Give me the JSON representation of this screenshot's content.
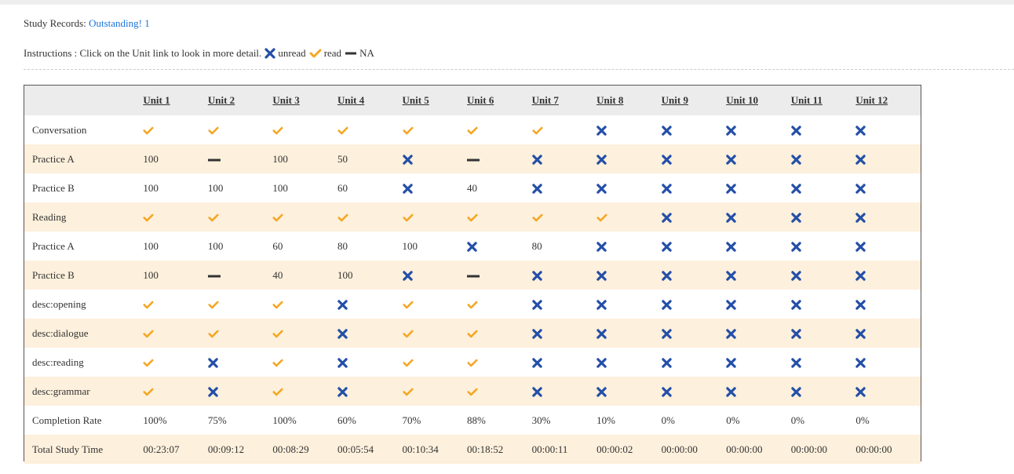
{
  "header": {
    "records_label": "Study Records:",
    "records_link": "Outstanding! 1",
    "instructions_text": "Instructions : Click on the Unit link to look in more detail.",
    "legend": {
      "unread": "unread",
      "read": "read",
      "na": "NA"
    }
  },
  "colors": {
    "read": "#f5a623",
    "unread": "#244fa8",
    "na": "#333333",
    "link": "#1a73d9",
    "alt_row": "#fdf0dc"
  },
  "units": [
    "Unit 1",
    "Unit 2",
    "Unit 3",
    "Unit 4",
    "Unit 5",
    "Unit 6",
    "Unit 7",
    "Unit 8",
    "Unit 9",
    "Unit 10",
    "Unit 11",
    "Unit 12"
  ],
  "rows": [
    {
      "label": "Conversation",
      "cells": [
        "read",
        "read",
        "read",
        "read",
        "read",
        "read",
        "read",
        "unread",
        "unread",
        "unread",
        "unread",
        "unread"
      ]
    },
    {
      "label": "Practice A",
      "cells": [
        "100",
        "na",
        "100",
        "50",
        "unread",
        "na",
        "unread",
        "unread",
        "unread",
        "unread",
        "unread",
        "unread"
      ]
    },
    {
      "label": "Practice B",
      "cells": [
        "100",
        "100",
        "100",
        "60",
        "unread",
        "40",
        "unread",
        "unread",
        "unread",
        "unread",
        "unread",
        "unread"
      ]
    },
    {
      "label": "Reading",
      "cells": [
        "read",
        "read",
        "read",
        "read",
        "read",
        "read",
        "read",
        "read",
        "unread",
        "unread",
        "unread",
        "unread"
      ]
    },
    {
      "label": "Practice A",
      "cells": [
        "100",
        "100",
        "60",
        "80",
        "100",
        "unread",
        "80",
        "unread",
        "unread",
        "unread",
        "unread",
        "unread"
      ]
    },
    {
      "label": "Practice B",
      "cells": [
        "100",
        "na",
        "40",
        "100",
        "unread",
        "na",
        "unread",
        "unread",
        "unread",
        "unread",
        "unread",
        "unread"
      ]
    },
    {
      "label": "desc:opening",
      "cells": [
        "read",
        "read",
        "read",
        "unread",
        "read",
        "read",
        "unread",
        "unread",
        "unread",
        "unread",
        "unread",
        "unread"
      ]
    },
    {
      "label": "desc:dialogue",
      "cells": [
        "read",
        "read",
        "read",
        "unread",
        "read",
        "read",
        "unread",
        "unread",
        "unread",
        "unread",
        "unread",
        "unread"
      ]
    },
    {
      "label": "desc:reading",
      "cells": [
        "read",
        "unread",
        "read",
        "unread",
        "read",
        "read",
        "unread",
        "unread",
        "unread",
        "unread",
        "unread",
        "unread"
      ]
    },
    {
      "label": "desc:grammar",
      "cells": [
        "read",
        "unread",
        "read",
        "unread",
        "read",
        "read",
        "unread",
        "unread",
        "unread",
        "unread",
        "unread",
        "unread"
      ]
    },
    {
      "label": "Completion Rate",
      "cells": [
        "100%",
        "75%",
        "100%",
        "60%",
        "70%",
        "88%",
        "30%",
        "10%",
        "0%",
        "0%",
        "0%",
        "0%"
      ]
    },
    {
      "label": "Total Study Time",
      "cells": [
        "00:23:07",
        "00:09:12",
        "00:08:29",
        "00:05:54",
        "00:10:34",
        "00:18:52",
        "00:00:11",
        "00:00:02",
        "00:00:00",
        "00:00:00",
        "00:00:00",
        "00:00:00"
      ]
    }
  ]
}
